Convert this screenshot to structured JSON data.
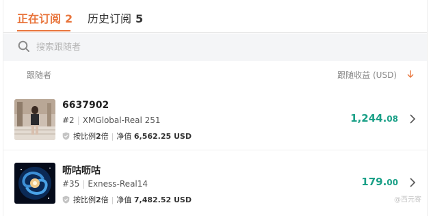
{
  "tabs": [
    {
      "label": "正在订阅",
      "count": "2"
    },
    {
      "label": "历史订阅",
      "count": "5"
    }
  ],
  "search": {
    "placeholder": "搜索跟随者"
  },
  "columns": {
    "follower": "跟随者",
    "profit": "跟随收益 (USD)"
  },
  "followers": [
    {
      "name": "6637902",
      "rank": "#2",
      "account": "XMGlobal-Real 251",
      "ratio_prefix": "按比例",
      "ratio_value": "2",
      "ratio_suffix": "倍",
      "equity_label": "净值",
      "equity_value": "6,562.25 USD",
      "profit_int": "1,244.",
      "profit_dec": "08"
    },
    {
      "name": "呖咕呖咕",
      "rank": "#35",
      "account": "Exness-Real14",
      "ratio_prefix": "按比例",
      "ratio_value": "2",
      "ratio_suffix": "倍",
      "equity_label": "净值",
      "equity_value": "7,482.52 USD",
      "profit_int": "179.",
      "profit_dec": "00"
    }
  ],
  "watermark": "@西元寄",
  "colors": {
    "accent": "#e8743b",
    "profit": "#1aa087"
  },
  "icons": [
    "search-icon",
    "sort-down-arrow-icon",
    "shield-icon",
    "chevron-right-icon"
  ]
}
